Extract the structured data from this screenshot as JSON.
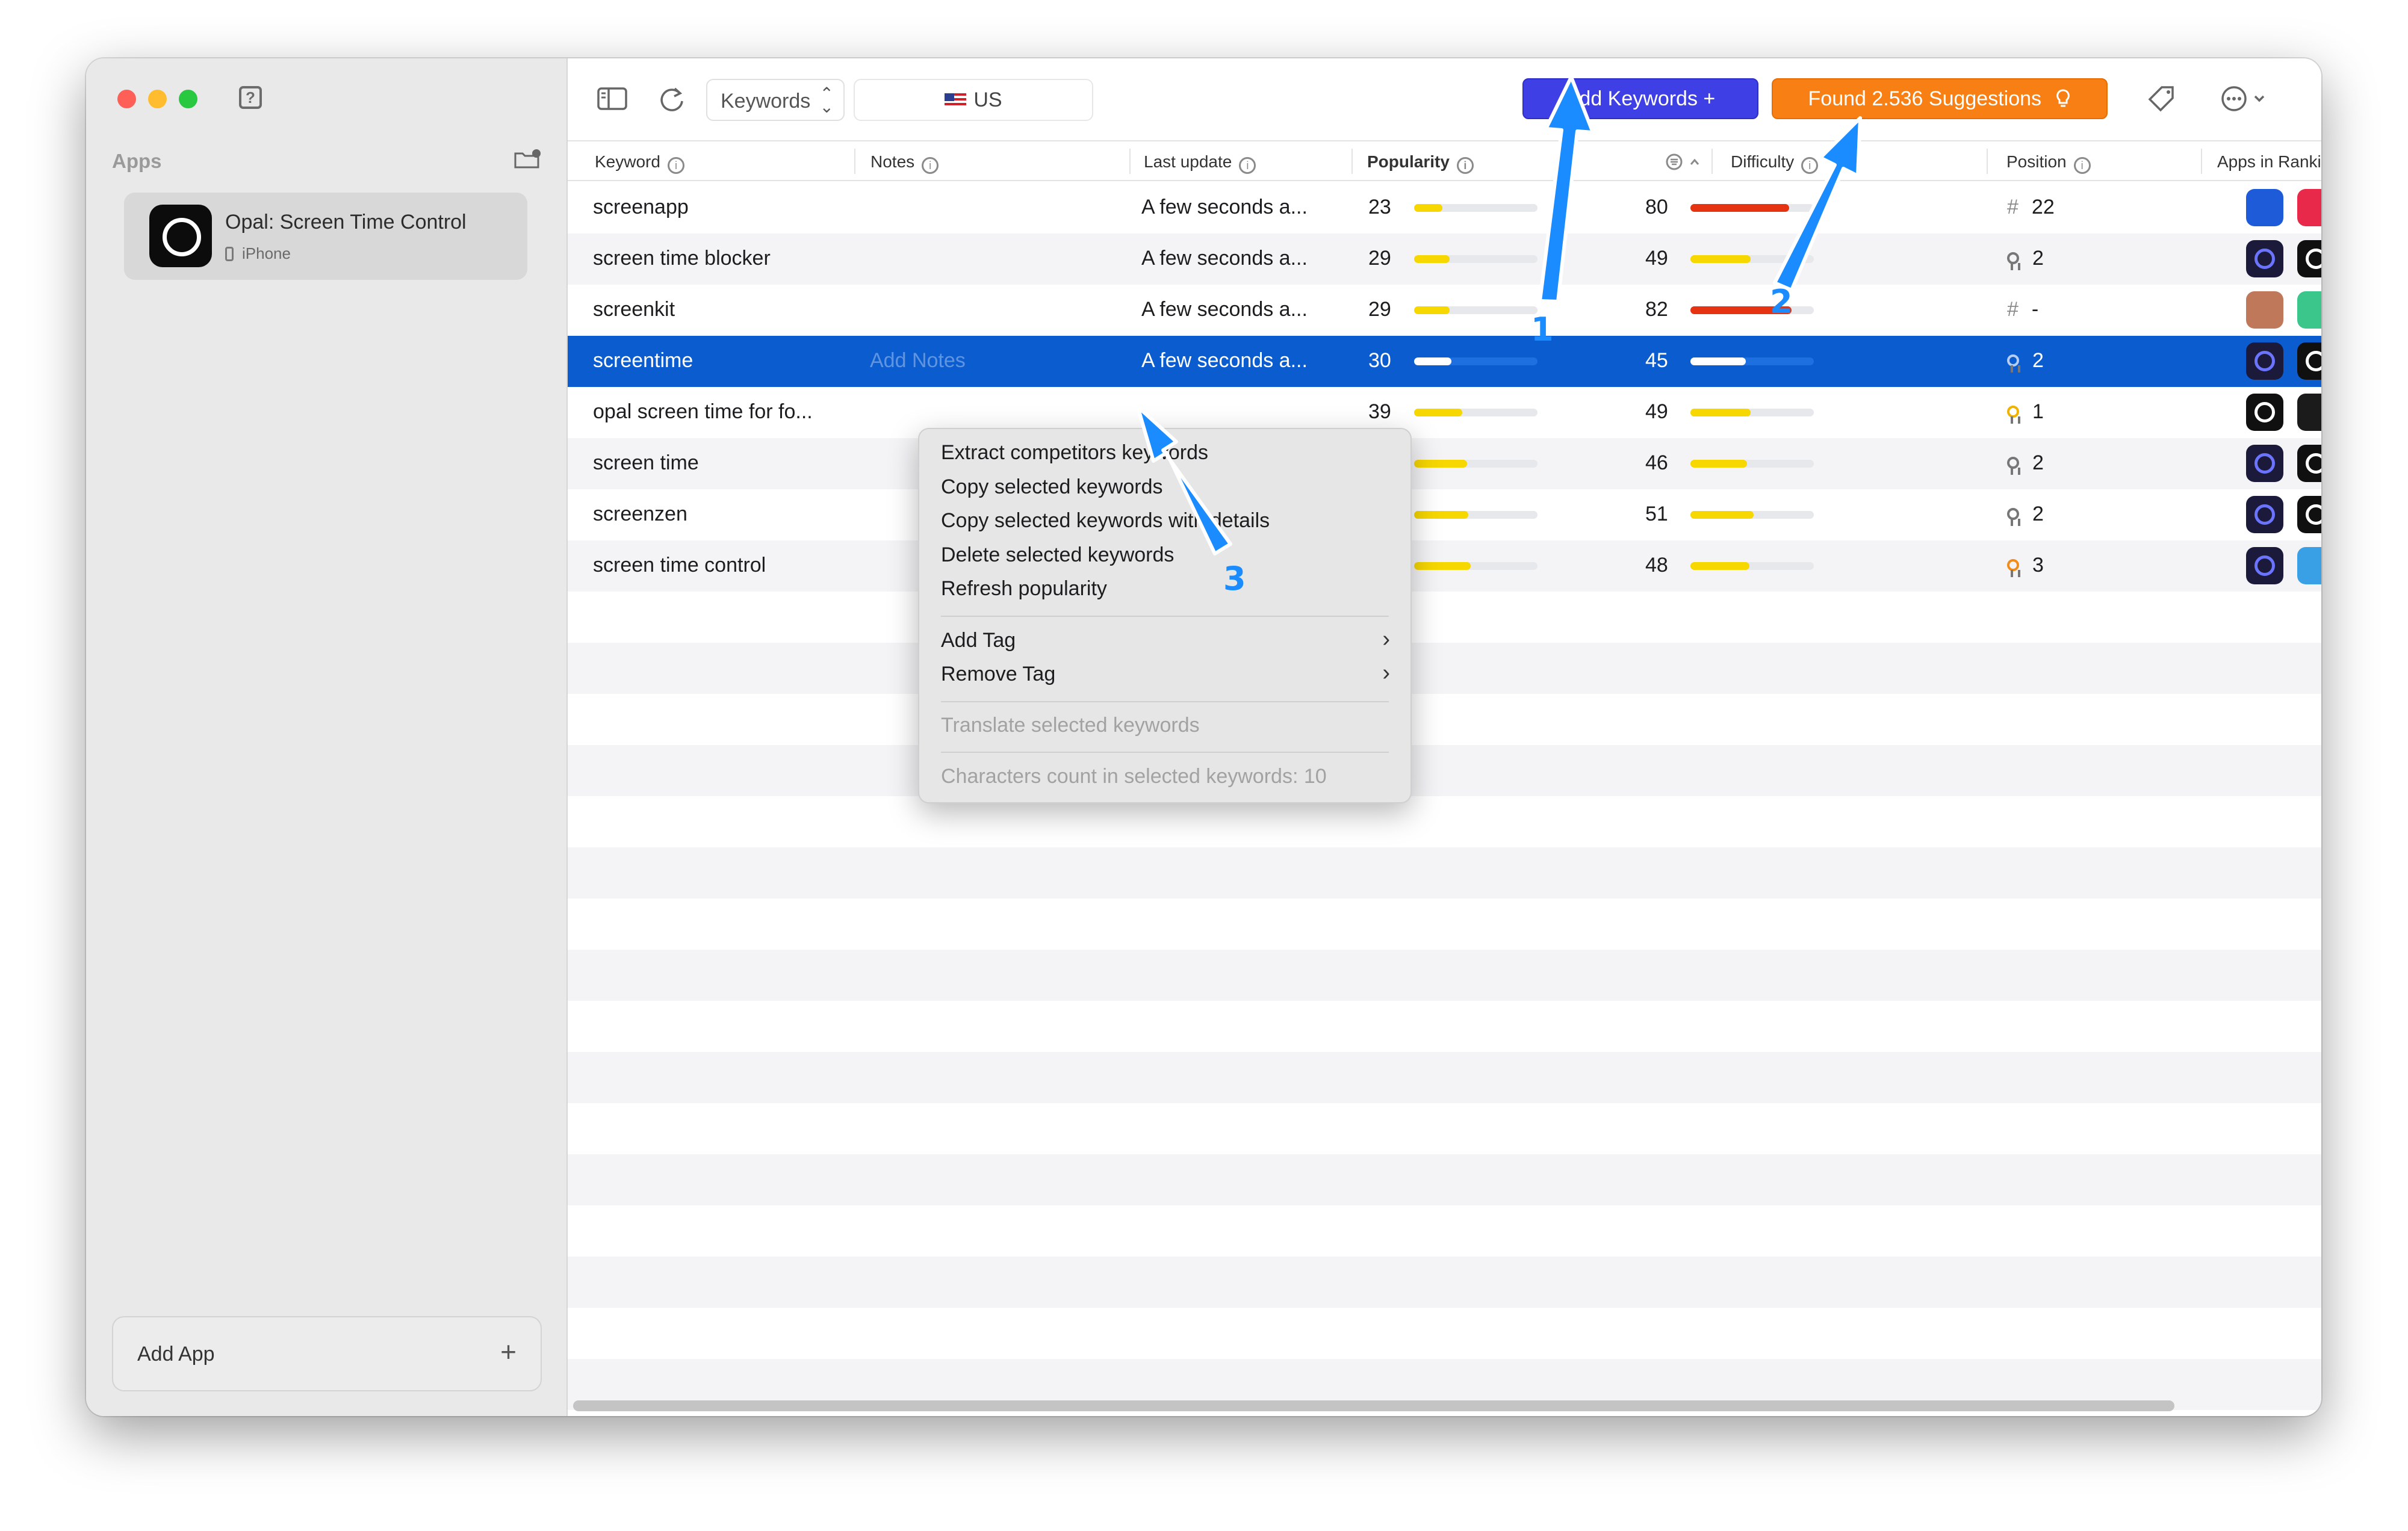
{
  "sidebar": {
    "section_title": "Apps",
    "app": {
      "name": "Opal: Screen Time Control",
      "device": "iPhone"
    },
    "add_app_label": "Add App",
    "add_app_plus": "+"
  },
  "toolbar": {
    "view_select": "Keywords",
    "country": "US",
    "add_keywords_label": "Add Keywords  +",
    "suggestions_label": "Found 2.536 Suggestions"
  },
  "columns": [
    "Keyword",
    "Notes",
    "Last update",
    "Popularity",
    "Difficulty",
    "Position",
    "Apps in Ranking"
  ],
  "rows": [
    {
      "keyword": "screenapp",
      "notes": "",
      "updated": "A few seconds a...",
      "popularity": 23,
      "difficulty": 80,
      "pos_kind": "hash",
      "position": "22",
      "selected": false
    },
    {
      "keyword": "screen time blocker",
      "notes": "",
      "updated": "A few seconds a...",
      "popularity": 29,
      "difficulty": 49,
      "pos_kind": "ribbon",
      "position": "2",
      "selected": false
    },
    {
      "keyword": "screenkit",
      "notes": "",
      "updated": "A few seconds a...",
      "popularity": 29,
      "difficulty": 82,
      "pos_kind": "hash",
      "position": "-",
      "selected": false
    },
    {
      "keyword": "screentime",
      "notes": "Add Notes",
      "updated": "A few seconds a...",
      "popularity": 30,
      "difficulty": 45,
      "pos_kind": "ribbon",
      "position": "2",
      "selected": true
    },
    {
      "keyword": "opal screen time for fo...",
      "notes": "",
      "updated": "",
      "popularity": 39,
      "difficulty": 49,
      "pos_kind": "gold",
      "position": "1",
      "selected": false
    },
    {
      "keyword": "screen time",
      "notes": "",
      "updated": "",
      "popularity": 43,
      "difficulty": 46,
      "pos_kind": "ribbon",
      "position": "2",
      "selected": false
    },
    {
      "keyword": "screenzen",
      "notes": "",
      "updated": "",
      "popularity": 44,
      "difficulty": 51,
      "pos_kind": "ribbon",
      "position": "2",
      "selected": false
    },
    {
      "keyword": "screen time control",
      "notes": "",
      "updated": "",
      "popularity": 46,
      "difficulty": 48,
      "pos_kind": "bronze",
      "position": "3",
      "selected": false
    }
  ],
  "rank_icon_colors": [
    [
      "#1e5bd8",
      "#e8294a",
      "#f0374f",
      "#f1e4f1"
    ],
    [
      "#1b1a3a",
      "#101010",
      "#0d8a4a",
      "#0e0e0e"
    ],
    [
      "#c0785a",
      "#3bc78c",
      "#f7d7cf",
      "#0c1a3a"
    ],
    [
      "#1b1a3a",
      "#101010",
      "#13306b",
      "#153560"
    ],
    [
      "#101010",
      "#1b1b1b",
      "#1b1a3a",
      "#f5c9c0"
    ],
    [
      "#1b1a3a",
      "#101010",
      "#2a4a8c",
      "#dfeffc"
    ],
    [
      "#1b1a3a",
      "#101010",
      "#2a4a8c",
      "#dfeffc"
    ],
    [
      "#1b1a3a",
      "#3aa0e6",
      "#101010",
      "#dfeffc"
    ]
  ],
  "context_menu": {
    "items": [
      "Extract competitors keywords",
      "Copy selected keywords",
      "Copy selected keywords with details",
      "Delete selected keywords",
      "Refresh popularity"
    ],
    "tag_items": [
      "Add Tag",
      "Remove Tag"
    ],
    "translate": "Translate selected keywords",
    "char_count": "Characters count in selected keywords: 10"
  },
  "annotations": [
    "1",
    "2",
    "3"
  ],
  "colors": {
    "selected_row": "#0a5ccf",
    "popularity_bar": "#f7d700",
    "difficulty_high": "#e63312",
    "add_button": "#3f3fe6",
    "suggest_button": "#f77f14",
    "annotation_arrow": "#1a8cff"
  }
}
